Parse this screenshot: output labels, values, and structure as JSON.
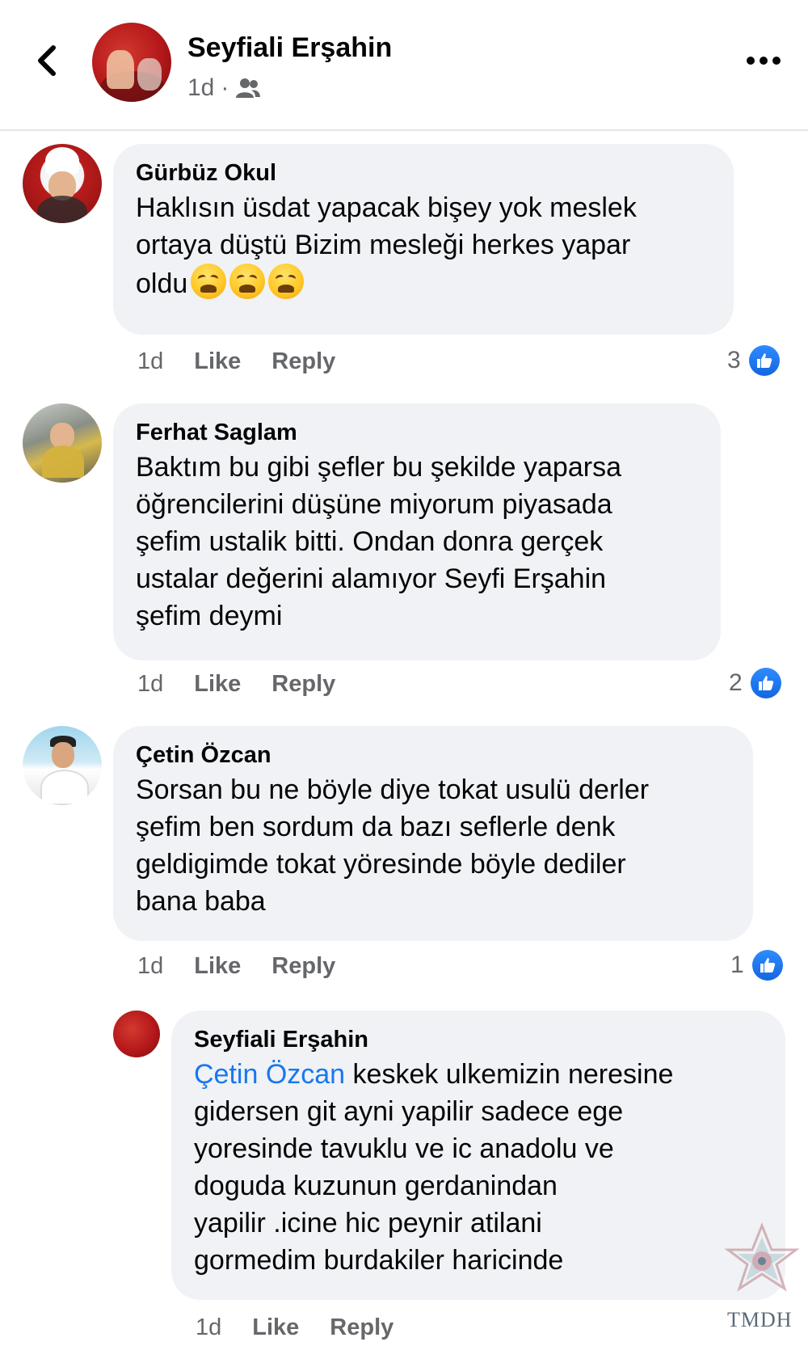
{
  "header": {
    "name": "Seyfiali Erşahin",
    "time": "1d",
    "separator": "·",
    "audience_icon": "friends-icon",
    "back_icon": "chevron-left-icon",
    "more_icon": "more-horizontal-icon"
  },
  "comments": [
    {
      "author": "Gürbüz Okul",
      "text": "Haklısın üsdat yapacak bişey yok meslek\nortaya düştü Bizim mesleği herkes yapar\noldu",
      "time": "1d",
      "like_label": "Like",
      "reply_label": "Reply",
      "reaction_count": "3"
    },
    {
      "author": "Ferhat Saglam",
      "text": "Baktım bu gibi şefler bu şekilde yaparsa\nöğrencilerini düşüne miyorum piyasada\nşefim  ustalik bitti. Ondan donra gerçek\nustalar değerini   alamıyor  Seyfi Erşahin\nşefim deymi",
      "time": "1d",
      "like_label": "Like",
      "reply_label": "Reply",
      "reaction_count": "2"
    },
    {
      "author": "Çetin Özcan",
      "text": "Sorsan bu ne böyle diye tokat usulü derler\nşefim ben sordum da bazı seflerle denk\ngeldigimde tokat yöresinde böyle dediler\nbana baba",
      "time": "1d",
      "like_label": "Like",
      "reply_label": "Reply",
      "reaction_count": "1"
    }
  ],
  "reply": {
    "author": "Seyfiali Erşahin",
    "mention": "Çetin Özcan",
    "text": "  keskek  ulkemizin neresine\ngidersen git  ayni yapilir  sadece  ege\nyoresinde  tavuklu  ve ic anadolu ve\ndoguda  kuzunun gerdanindan\nyapilir .icine  hic peynir atilani\ngormedim burdakiler haricinde",
    "time": "1d",
    "like_label": "Like",
    "reply_label": "Reply"
  },
  "watermark": "TMDH",
  "colors": {
    "bubble": "#f0f2f5",
    "link": "#1877f2",
    "meta": "#65676b",
    "like_badge": "#1877f2"
  }
}
